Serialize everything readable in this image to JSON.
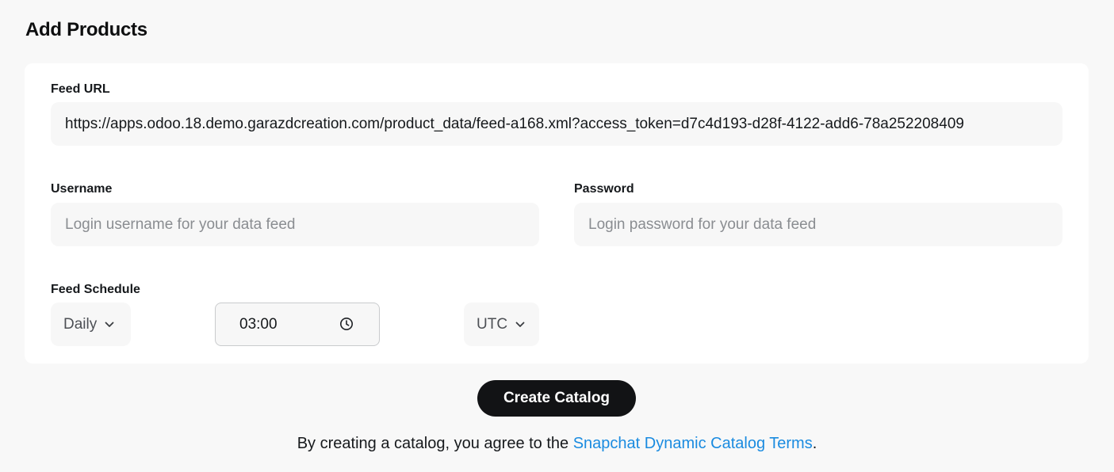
{
  "page": {
    "title": "Add Products"
  },
  "feed_url": {
    "label": "Feed URL",
    "value": "https://apps.odoo.18.demo.garazdcreation.com/product_data/feed-a168.xml?access_token=d7c4d193-d28f-4122-add6-78a252208409"
  },
  "username": {
    "label": "Username",
    "placeholder": "Login username for your data feed",
    "value": ""
  },
  "password": {
    "label": "Password",
    "placeholder": "Login password for your data feed",
    "value": ""
  },
  "schedule": {
    "label": "Feed Schedule",
    "frequency": "Daily",
    "time": "03:00",
    "timezone": "UTC"
  },
  "actions": {
    "create_label": "Create Catalog"
  },
  "terms": {
    "prefix": "By creating a catalog, you agree to the ",
    "link_text": "Snapchat Dynamic Catalog Terms",
    "suffix": "."
  },
  "icons": {
    "chevron": "chevron-down-icon",
    "clock": "clock-icon"
  },
  "colors": {
    "button_bg": "#121315",
    "link": "#1a8be0",
    "page_bg": "#f8f8f8"
  }
}
